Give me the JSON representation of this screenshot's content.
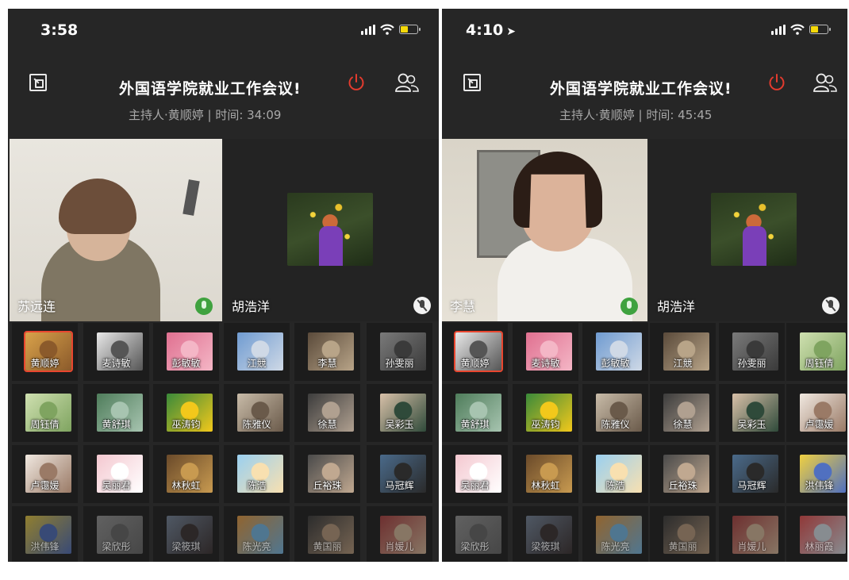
{
  "left": {
    "time": "3:58",
    "meeting_title": "外国语学院就业工作会议!",
    "meeting_info": "主持人·黄顺婷 | 时间: 34:09",
    "main_speaker": "苏远连",
    "second_speaker": "胡浩洋",
    "participants": [
      "黄顺婷",
      "麦诗敏",
      "彭敏敏",
      "江競",
      "李慧",
      "孙雯丽",
      "周钰倩",
      "黄舒琪",
      "巫涛钧",
      "陈雅仪",
      "徐慧",
      "吴彩玉",
      "卢霭媛",
      "吴丽君",
      "林秋虹",
      "陈浩",
      "丘裕珠",
      "马冠辉",
      "洪伟锋",
      "梁欣彤",
      "梁筱琪",
      "陈光亮",
      "黄国丽",
      "肖媛儿"
    ]
  },
  "right": {
    "time": "4:10",
    "meeting_title": "外国语学院就业工作会议!",
    "meeting_info": "主持人·黄顺婷 | 时间: 45:45",
    "main_speaker": "李慧",
    "second_speaker": "胡浩洋",
    "participants": [
      "黄顺婷",
      "麦诗敏",
      "彭敏敏",
      "江競",
      "孙雯丽",
      "周钰倩",
      "黄舒琪",
      "巫涛钧",
      "陈雅仪",
      "徐慧",
      "吴彩玉",
      "卢霭媛",
      "吴丽君",
      "林秋虹",
      "陈浩",
      "丘裕珠",
      "马冠辉",
      "洪伟锋",
      "梁欣彤",
      "梁筱琪",
      "陈光亮",
      "黄国丽",
      "肖媛儿",
      "林丽霞"
    ]
  },
  "colors": {
    "background": "#262626",
    "power": "#e23b2e",
    "mic_active": "#3fa23f",
    "host_border": "#e9462f",
    "battery": "#f5d90a"
  }
}
